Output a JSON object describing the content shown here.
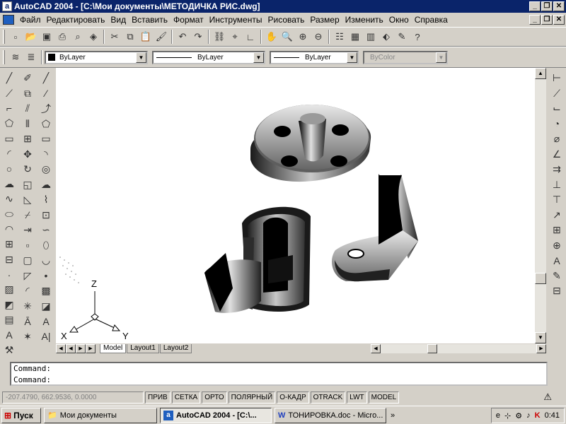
{
  "window": {
    "title": "AutoCAD 2004 - [C:\\Мои документы\\МЕТОДИЧКА РИС.dwg]"
  },
  "menu": [
    "Файл",
    "Редактировать",
    "Вид",
    "Вставить",
    "Формат",
    "Инструменты",
    "Рисовать",
    "Размер",
    "Изменить",
    "Окно",
    "Справка"
  ],
  "properties": {
    "color": "ByLayer",
    "linetype": "ByLayer",
    "lineweight": "ByLayer",
    "plotstyle": "ByColor"
  },
  "ucs": {
    "x": "X",
    "y": "Y",
    "z": "Z"
  },
  "layout_tabs": [
    "Model",
    "Layout1",
    "Layout2"
  ],
  "command": {
    "line1": "Command:",
    "line2": "Command:"
  },
  "status": {
    "coords": "-207.4790, 662.9536, 0.0000",
    "buttons": [
      "ПРИВ",
      "СЕТКА",
      "ОРТО",
      "ПОЛЯРНЫЙ",
      "О-КАДР",
      "OTRACK",
      "LWT",
      "MODEL"
    ]
  },
  "taskbar": {
    "start": "Пуск",
    "tasks": [
      "Мои документы",
      "AutoCAD 2004 - [C:\\...",
      "ТОНИРОВКА.doc - Micro..."
    ],
    "clock": "0:41"
  },
  "colors": {
    "titlebar": "#0a246a",
    "canvas": "#ffffff",
    "chrome": "#d4d0c8"
  }
}
